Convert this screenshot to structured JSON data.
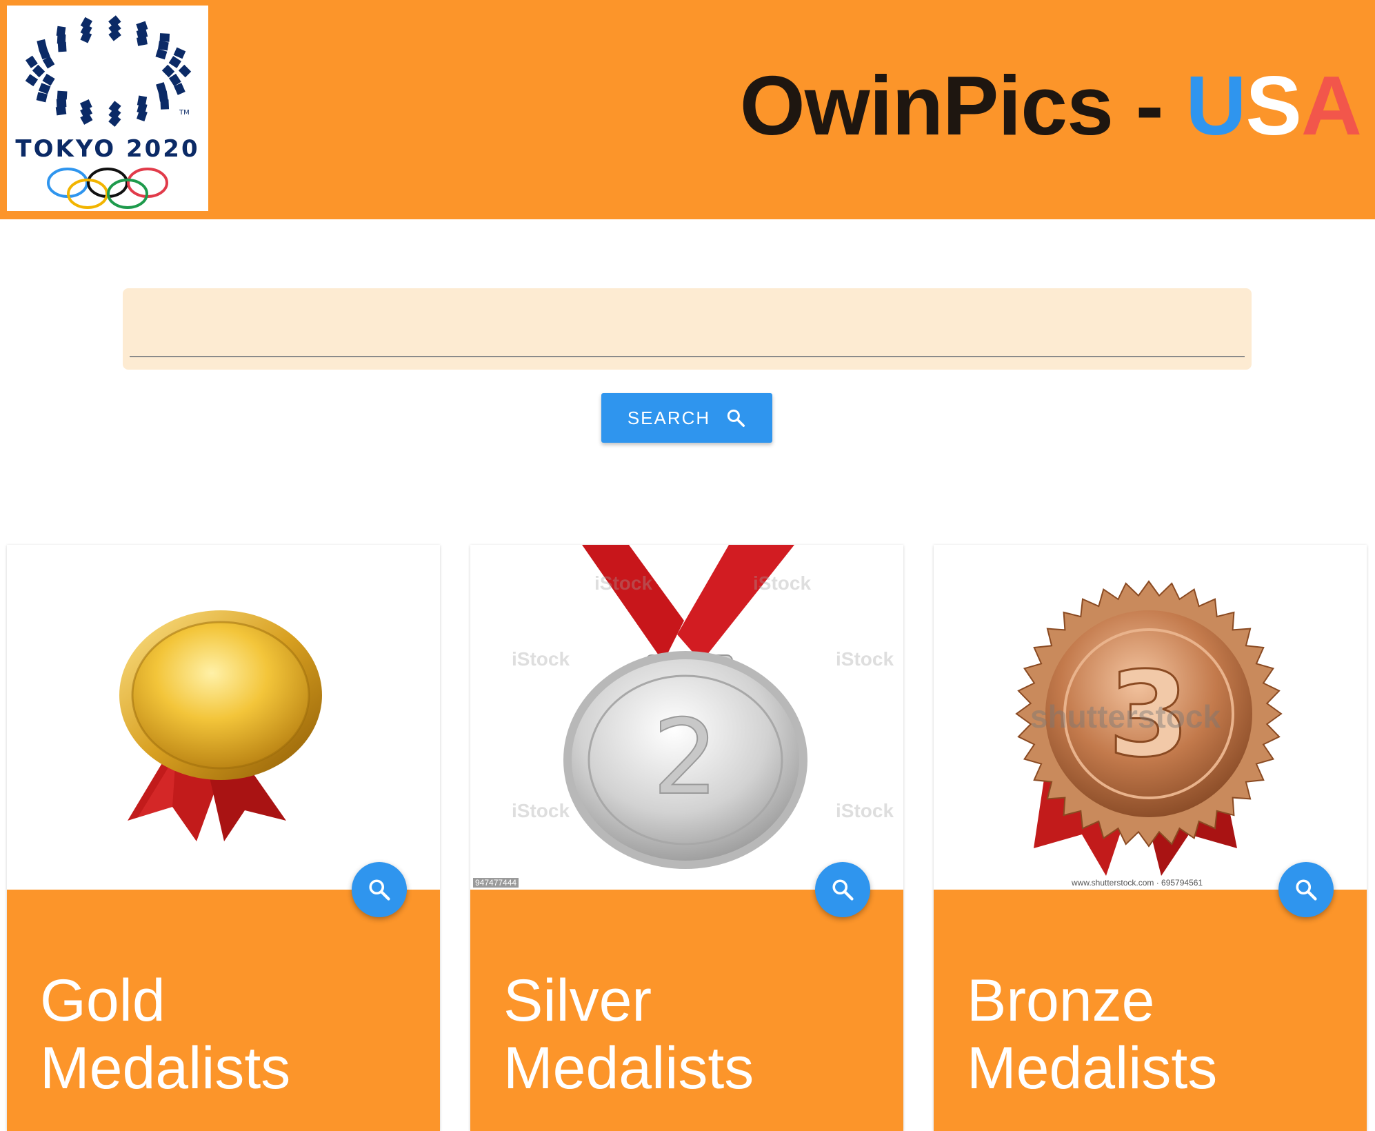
{
  "header": {
    "logo_text": "TOKYO 2020",
    "title_main": "OwinPics - ",
    "title_u": "U",
    "title_s": "S",
    "title_a": "A",
    "colors": {
      "background": "#fc952a",
      "u": "#2f95ee",
      "s": "#ffffff",
      "a": "#f2564b"
    }
  },
  "search": {
    "value": "",
    "placeholder": "",
    "button_label": "SEARCH",
    "button_icon": "search-icon"
  },
  "cards": [
    {
      "title_line1": "Gold",
      "title_line2": "Medalists",
      "image": "gold-medal",
      "action_icon": "search-icon"
    },
    {
      "title_line1": "Silver",
      "title_line2": "Medalists",
      "image": "silver-medal",
      "action_icon": "search-icon",
      "watermark": "iStock",
      "credit": "947477444"
    },
    {
      "title_line1": "Bronze",
      "title_line2": "Medalists",
      "image": "bronze-medal",
      "action_icon": "search-icon",
      "watermark": "shutterstock",
      "credit": "www.shutterstock.com · 695794561"
    }
  ],
  "colors": {
    "accent": "#2f95ee",
    "brand_orange": "#fc952a",
    "search_bg": "#fdebd2"
  }
}
